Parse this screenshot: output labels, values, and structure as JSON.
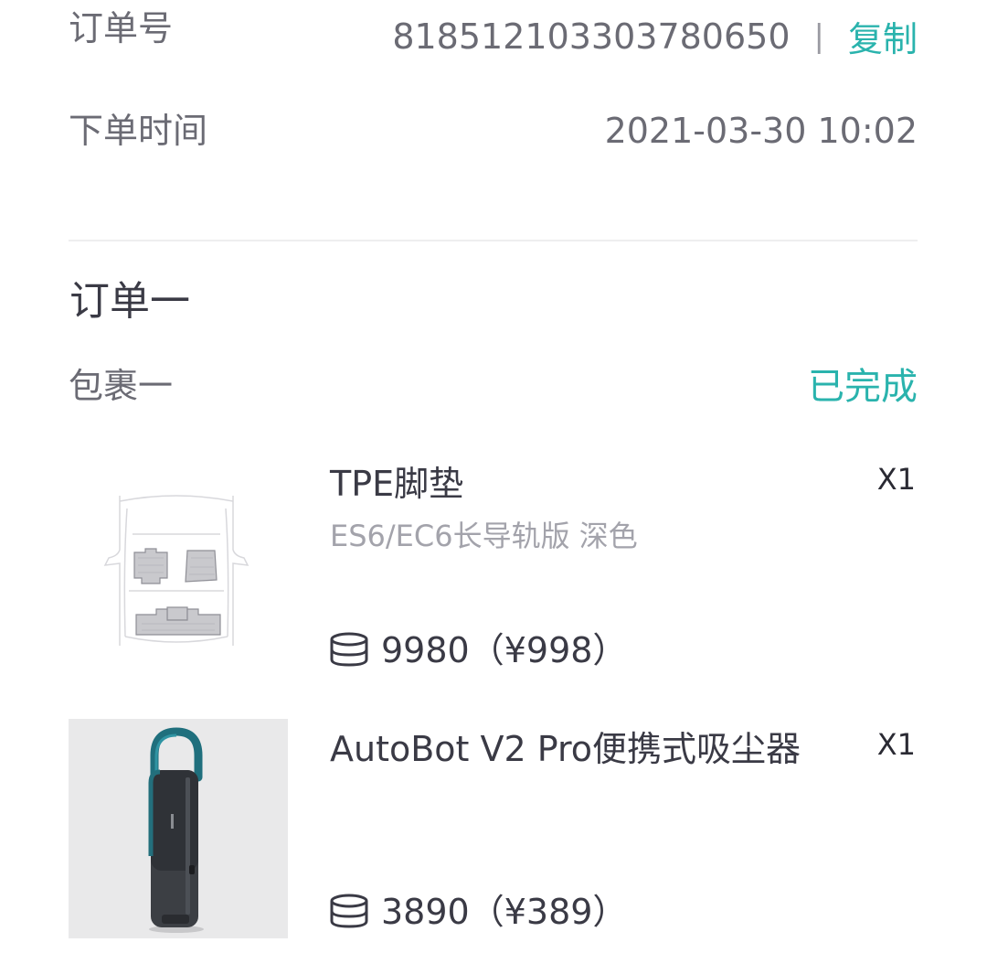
{
  "order_info": {
    "order_no_label": "订单号",
    "order_no": "818512103303780650",
    "separator": "|",
    "copy_label": "复制",
    "time_label": "下单时间",
    "time_value": "2021-03-30 10:02"
  },
  "order": {
    "title": "订单一",
    "package_label": "包裹一",
    "status": "已完成",
    "items": [
      {
        "name": "TPE脚垫",
        "spec": "ES6/EC6长导轨版 深色",
        "quantity": "X1",
        "points": "9980",
        "price": "（¥998）",
        "icon": "coin-stack-icon",
        "image": "car-floor-mat-diagram"
      },
      {
        "name": "AutoBot V2 Pro便携式吸尘器",
        "spec": "",
        "quantity": "X1",
        "points": "3890",
        "price": "（¥389）",
        "icon": "coin-stack-icon",
        "image": "handheld-vacuum-photo"
      }
    ]
  },
  "colors": {
    "accent": "#2ab3ad",
    "text_primary": "#3a3a45",
    "text_secondary": "#6b6b74",
    "text_muted": "#a3a3ab",
    "divider": "#eeeeef"
  }
}
